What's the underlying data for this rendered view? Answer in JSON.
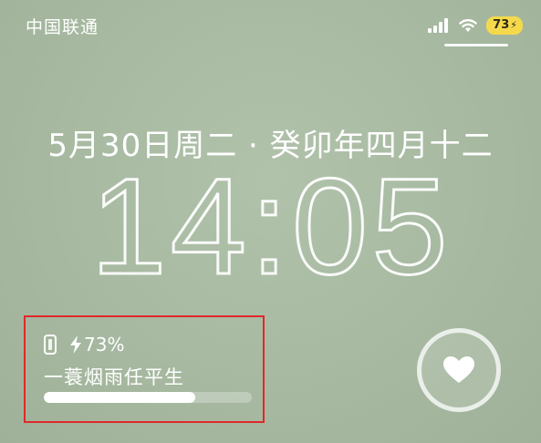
{
  "status_bar": {
    "carrier": "中国联通",
    "battery_percent": "73",
    "battery_badge_color": "#f5d94d",
    "icons": [
      "signal-icon",
      "wifi-icon",
      "charging-bolt-icon"
    ]
  },
  "lock_screen": {
    "date": "5月30日周二 · 癸卯年四月十二",
    "time": "14:05"
  },
  "battery_widget": {
    "device_icon": "phone-icon",
    "charging_icon": "bolt-icon",
    "percent_label": "73%",
    "device_name": "一蓑烟雨任平生",
    "level": 0.73,
    "highlight_color": "#e0282a"
  },
  "heart_widget": {
    "icon": "heart-icon"
  },
  "colors": {
    "wallpaper": "#a9bba3",
    "text": "#ffffff"
  }
}
